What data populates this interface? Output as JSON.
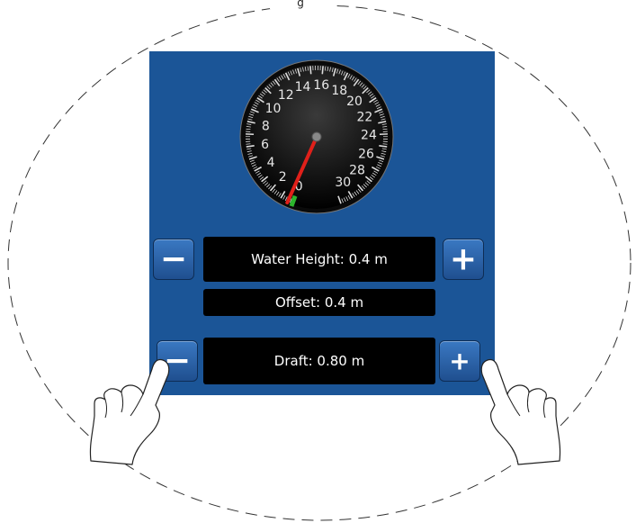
{
  "header": {
    "label": "g"
  },
  "gauge": {
    "dial_numbers": [
      "0",
      "2",
      "4",
      "6",
      "8",
      "10",
      "12",
      "14",
      "16",
      "18",
      "20",
      "22",
      "24",
      "26",
      "28",
      "30"
    ],
    "needle_value": 0.4,
    "needle_color": "#e0201a",
    "zero_marker_color": "#2db52d",
    "face_color": "#111111"
  },
  "water_height": {
    "minus_label": "−",
    "value_text": "Water Height: 0.4 m",
    "plus_label": "+"
  },
  "offset": {
    "value_text": "Offset: 0.4 m"
  },
  "draft": {
    "minus_label": "−",
    "value_text": "Draft: 0.80 m",
    "plus_label": "+"
  },
  "colors": {
    "panel": "#1b5597",
    "button": "#2c64ab",
    "readout": "#000000"
  }
}
